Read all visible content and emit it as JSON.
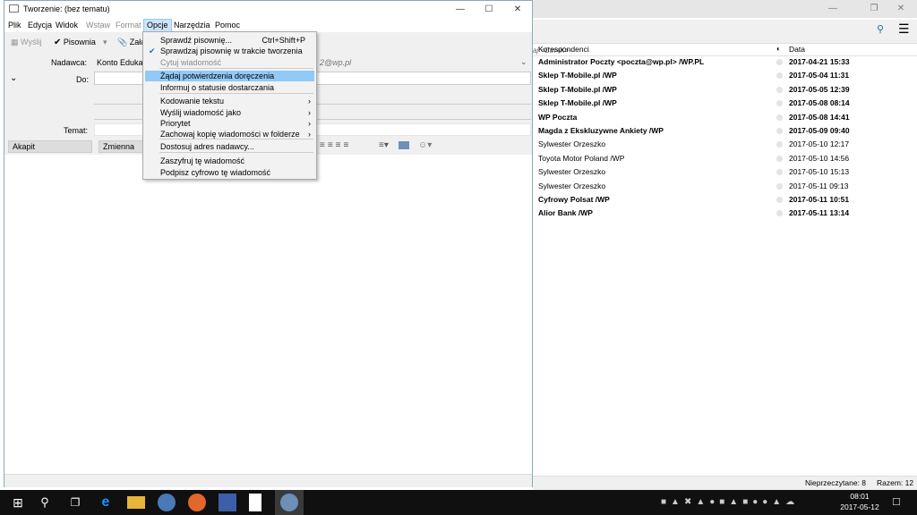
{
  "background_window": {
    "search_placeholder": "aj <Ctrl+K>",
    "columns": {
      "from": "Korespondenci",
      "date": "Data"
    },
    "messages": [
      {
        "from": "Administrator Poczty <poczta@wp.pl> /WP.PL",
        "date": "2017-04-21 15:33",
        "unread": true
      },
      {
        "from": "Sklep T-Mobile.pl /WP",
        "date": "2017-05-04 11:31",
        "unread": true
      },
      {
        "from": "Sklep T-Mobile.pl /WP",
        "date": "2017-05-05 12:39",
        "unread": true
      },
      {
        "from": "Sklep T-Mobile.pl /WP",
        "date": "2017-05-08 08:14",
        "unread": true
      },
      {
        "from": "WP Poczta",
        "date": "2017-05-08 14:41",
        "unread": true
      },
      {
        "from": "Magda z Ekskluzywne Ankiety /WP",
        "date": "2017-05-09 09:40",
        "unread": true
      },
      {
        "from": "Sylwester Orzeszko",
        "date": "2017-05-10 12:17",
        "unread": false
      },
      {
        "from": "Toyota Motor Poland /WP",
        "date": "2017-05-10 14:56",
        "unread": false
      },
      {
        "from": "Sylwester Orzeszko",
        "date": "2017-05-10 15:13",
        "unread": false
      },
      {
        "from": "Sylwester Orzeszko",
        "date": "2017-05-11 09:13",
        "unread": false
      },
      {
        "from": "Cyfrowy Polsat /WP",
        "date": "2017-05-11 10:51",
        "unread": true
      },
      {
        "from": "Alior Bank /WP",
        "date": "2017-05-11 13:14",
        "unread": true
      }
    ],
    "status": {
      "unread": "Nieprzeczytane: 8",
      "total": "Razem: 12"
    }
  },
  "compose": {
    "title": "Tworzenie: (bez tematu)",
    "menus": [
      "Plik",
      "Edycja",
      "Widok",
      "Wstaw",
      "Format",
      "Opcje",
      "Narzędzia",
      "Pomoc"
    ],
    "toolbar": {
      "send": "Wyślij",
      "spelling": "Pisownia",
      "attach": "Załą"
    },
    "from_label": "Nadawca:",
    "from_value": "Konto Edukacy",
    "from_value_tail": "2@wp.pl",
    "to_label": "Do:",
    "subject_label": "Temat:",
    "format_paragraph": "Akapit",
    "format_font": "Zmienna sze"
  },
  "dropdown": {
    "items": [
      {
        "label": "Sprawdź pisownię...",
        "shortcut": "Ctrl+Shift+P"
      },
      {
        "label": "Sprawdzaj pisownię w trakcie tworzenia",
        "checked": true
      },
      {
        "label": "Cytuj wiadomość",
        "disabled": true
      },
      {
        "label": "Żądaj potwierdzenia doręczenia",
        "highlighted": true
      },
      {
        "label": "Informuj o statusie dostarczania"
      },
      {
        "label": "Kodowanie tekstu",
        "submenu": true
      },
      {
        "label": "Wyślij wiadomość jako",
        "submenu": true
      },
      {
        "label": "Priorytet",
        "submenu": true
      },
      {
        "label": "Zachowaj kopię wiadomości w folderze",
        "submenu": true
      },
      {
        "label": "Dostosuj adres nadawcy..."
      },
      {
        "label": "Zaszyfruj tę wiadomość"
      },
      {
        "label": "Podpisz cyfrowo tę wiadomość"
      }
    ]
  },
  "taskbar": {
    "time": "08:01",
    "date": "2017-05-12"
  },
  "colors": {
    "highlight": "#91c9f7",
    "taskbar": "#101010",
    "menu_open": "#cce4f7"
  }
}
